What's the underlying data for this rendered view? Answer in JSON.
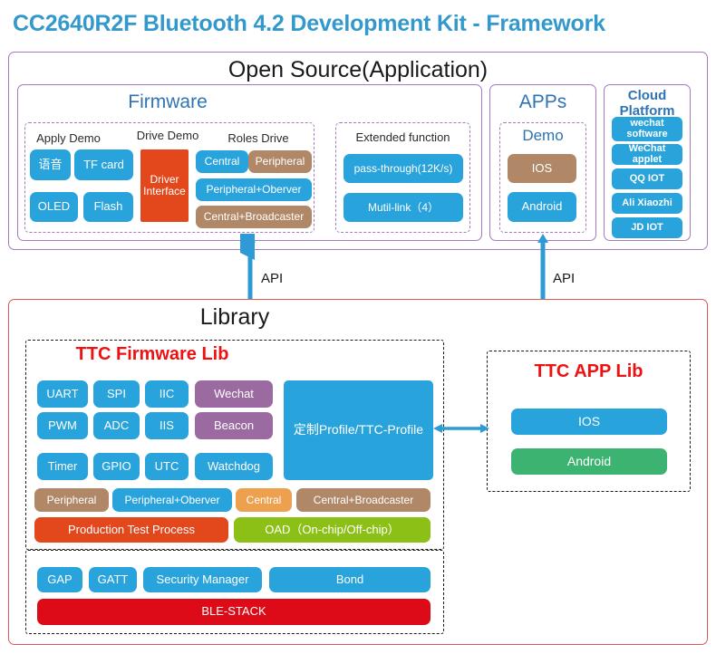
{
  "title": "CC2640R2F Bluetooth 4.2 Development Kit - Framework",
  "colors": {
    "title_blue": "#3399cc",
    "panel_purple": "#a878c0",
    "panel_red": "#e05555",
    "heading_blue": "#2e74b5",
    "heading_red": "#ee1111",
    "chip_blue": "#29a3dc",
    "chip_blue_dark": "#1e9ad6",
    "chip_brown": "#b08868",
    "chip_orange_red": "#e2481b",
    "chip_orange": "#eda14e",
    "chip_purple": "#9b6aa0",
    "chip_green": "#8cc016",
    "chip_green_app": "#3cb371",
    "chip_red": "#dd0a18",
    "arrow_blue": "#2e9bd6"
  },
  "open_source": {
    "heading": "Open Source(Application)",
    "firmware": {
      "heading": "Firmware",
      "groups": [
        {
          "label": "Apply Demo",
          "chips": [
            {
              "text": "语音",
              "color": "#29a3dc"
            },
            {
              "text": "TF card",
              "color": "#29a3dc"
            },
            {
              "text": "OLED",
              "color": "#29a3dc"
            },
            {
              "text": "Flash",
              "color": "#29a3dc"
            }
          ]
        },
        {
          "label": "Drive Demo",
          "chips": [
            {
              "text": "Driver Interface",
              "color": "#e2481b"
            }
          ]
        },
        {
          "label": "Roles Drive",
          "chips": [
            {
              "text": "Central",
              "color": "#29a3dc"
            },
            {
              "text": "Peripheral",
              "color": "#b08868"
            },
            {
              "text": "Peripheral+Oberver",
              "color": "#29a3dc"
            },
            {
              "text": "Central+Broadcaster",
              "color": "#b08868"
            }
          ]
        }
      ],
      "extended": {
        "label": "Extended function",
        "chips": [
          {
            "text": "pass-through(12K/s)",
            "color": "#29a3dc"
          },
          {
            "text": "Mutil-link（4）",
            "color": "#29a3dc"
          }
        ]
      }
    },
    "apps": {
      "heading": "APPs",
      "demo_label": "Demo",
      "chips": [
        {
          "text": "IOS",
          "color": "#b08868"
        },
        {
          "text": "Android",
          "color": "#29a3dc"
        }
      ]
    },
    "cloud": {
      "heading_line1": "Cloud",
      "heading_line2": "Platform",
      "chips": [
        {
          "text": "wechat software",
          "color": "#29a3dc"
        },
        {
          "text": "WeChat applet",
          "color": "#29a3dc"
        },
        {
          "text": "QQ IOT",
          "color": "#29a3dc"
        },
        {
          "text": "Ali Xiaozhi",
          "color": "#29a3dc"
        },
        {
          "text": "JD IOT",
          "color": "#29a3dc"
        }
      ]
    }
  },
  "connectors": {
    "api_left": "API",
    "api_right": "API"
  },
  "library": {
    "heading": "Library",
    "firmware_lib": {
      "heading": "TTC Firmware Lib",
      "peripherals_grid": [
        {
          "text": "UART",
          "color": "#29a3dc"
        },
        {
          "text": "SPI",
          "color": "#29a3dc"
        },
        {
          "text": "IIC",
          "color": "#29a3dc"
        },
        {
          "text": "Wechat",
          "color": "#9b6aa0"
        },
        {
          "text": "PWM",
          "color": "#29a3dc"
        },
        {
          "text": "ADC",
          "color": "#29a3dc"
        },
        {
          "text": "IIS",
          "color": "#29a3dc"
        },
        {
          "text": "Beacon",
          "color": "#9b6aa0"
        },
        {
          "text": "Timer",
          "color": "#29a3dc"
        },
        {
          "text": "GPIO",
          "color": "#29a3dc"
        },
        {
          "text": "UTC",
          "color": "#29a3dc"
        },
        {
          "text": "Watchdog",
          "color": "#29a3dc"
        }
      ],
      "profile": {
        "text": "定制Profile/TTC-Profile",
        "color": "#29a3dc"
      },
      "roles_row": [
        {
          "text": "Peripheral",
          "color": "#b08868"
        },
        {
          "text": "Peripheral+Oberver",
          "color": "#29a3dc"
        },
        {
          "text": "Central",
          "color": "#eda14e"
        },
        {
          "text": "Central+Broadcaster",
          "color": "#b08868"
        }
      ],
      "process_row": [
        {
          "text": "Production Test Process",
          "color": "#e2481b"
        },
        {
          "text": "OAD（On-chip/Off-chip）",
          "color": "#8cc016"
        }
      ]
    },
    "ble_stack": {
      "items": [
        {
          "text": "GAP",
          "color": "#29a3dc"
        },
        {
          "text": "GATT",
          "color": "#29a3dc"
        },
        {
          "text": "Security Manager",
          "color": "#29a3dc"
        },
        {
          "text": "Bond",
          "color": "#29a3dc"
        }
      ],
      "stack": {
        "text": "BLE-STACK",
        "color": "#dd0a18"
      }
    },
    "app_lib": {
      "heading": "TTC APP Lib",
      "chips": [
        {
          "text": "IOS",
          "color": "#29a3dc"
        },
        {
          "text": "Android",
          "color": "#3cb371"
        }
      ]
    }
  }
}
